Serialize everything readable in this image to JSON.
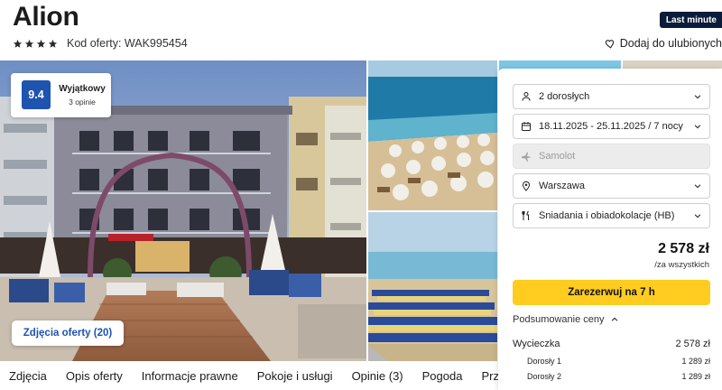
{
  "hotel": {
    "name": "Alion",
    "stars": 4,
    "offer_code": "Kod oferty: WAK995454",
    "badge": "Last minute",
    "favorite_label": "Dodaj do ulubionych"
  },
  "rating": {
    "score": "9.4",
    "label": "Wyjątkowy",
    "count": "3 opinie"
  },
  "gallery": {
    "button_label": "Zdjęcia oferty (20)"
  },
  "booking": {
    "travelers": {
      "icon": "person-icon",
      "value": "2 dorosłych"
    },
    "dates": {
      "icon": "calendar-icon",
      "value": "18.11.2025 - 25.11.2025 / 7 nocy"
    },
    "transport": {
      "icon": "plane-icon",
      "value": "Samolot"
    },
    "departure": {
      "icon": "location-pin-icon",
      "value": "Warszawa"
    },
    "board": {
      "icon": "cutlery-icon",
      "value": "Śniadania i obiadokolacje (HB)"
    },
    "price": "2 578 zł",
    "price_note": "/za wszystkich",
    "reserve_label": "Zarezerwuj na 7 h",
    "summary_label": "Podsumowanie ceny",
    "summary": {
      "trip_label": "Wycieczka",
      "trip_price": "2 578 zł",
      "lines": [
        {
          "label": "Dorosły 1",
          "price": "1 289 zł"
        },
        {
          "label": "Dorosły 2",
          "price": "1 289 zł"
        }
      ]
    }
  },
  "tabs": [
    "Zdjęcia",
    "Opis oferty",
    "Informacje prawne",
    "Pokoje i usługi",
    "Opinie (3)",
    "Pogoda",
    "Przed p"
  ],
  "colors": {
    "accent_blue": "#1e53b0",
    "reserve_yellow": "#ffcc1f",
    "badge_navy": "#0b1c3a"
  }
}
